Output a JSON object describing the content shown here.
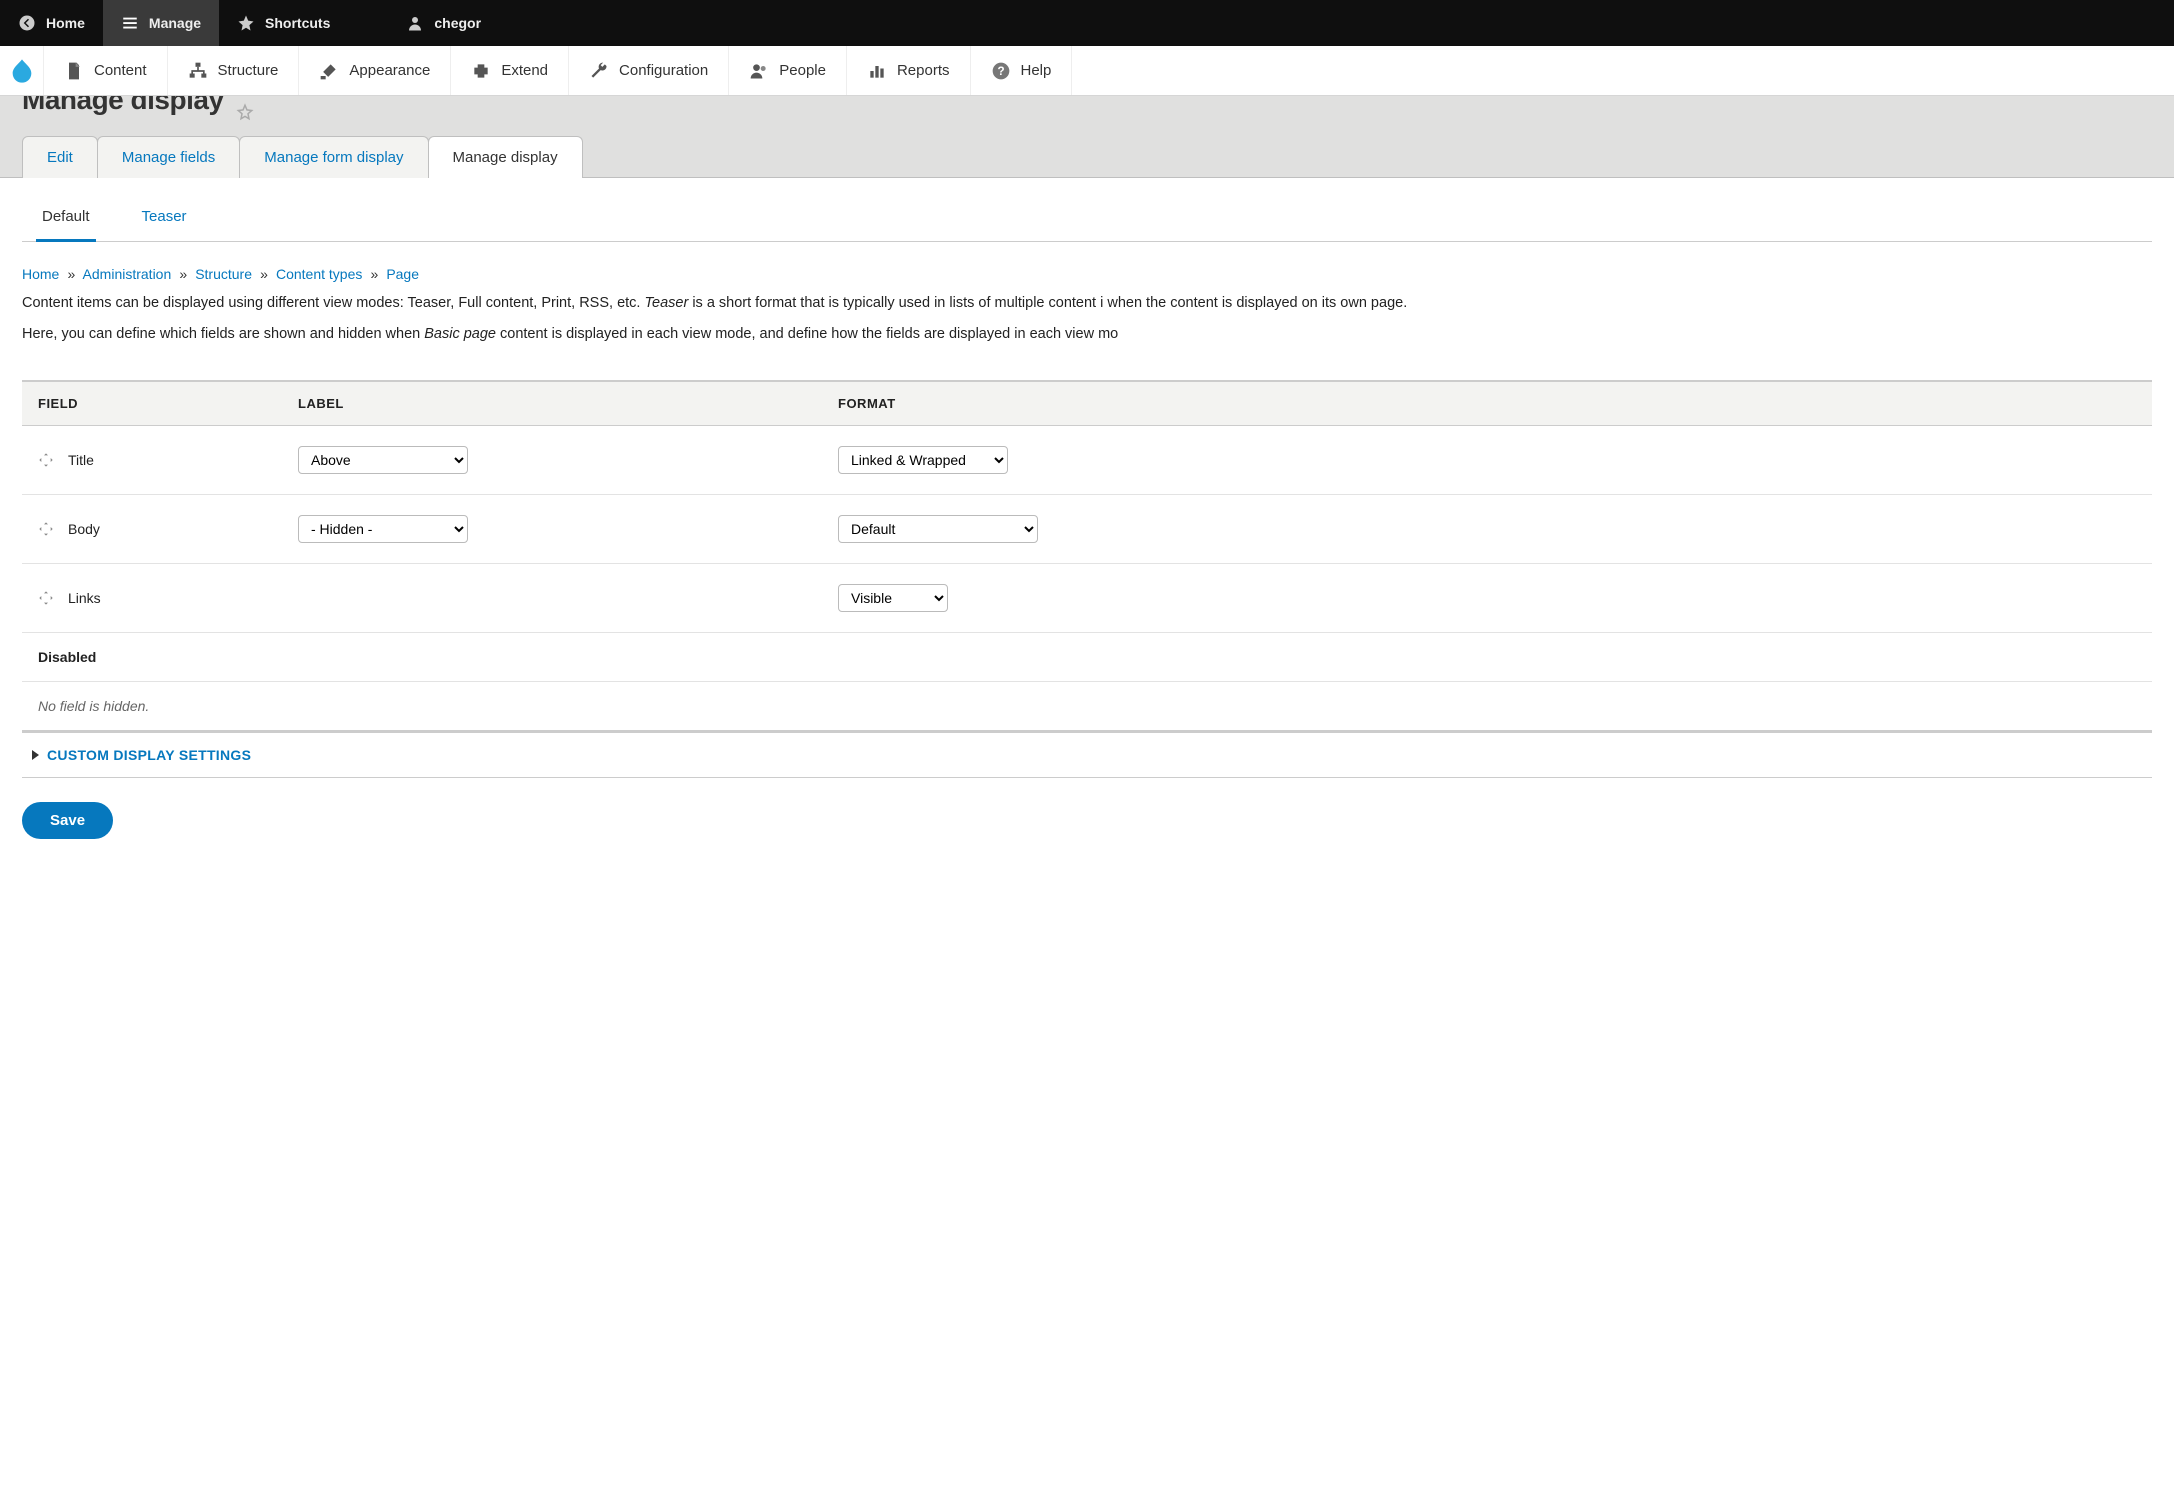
{
  "toolbar": {
    "home": "Home",
    "manage": "Manage",
    "shortcuts": "Shortcuts",
    "user": "chegor"
  },
  "adminbar": {
    "content": "Content",
    "structure": "Structure",
    "appearance": "Appearance",
    "extend": "Extend",
    "configuration": "Configuration",
    "people": "People",
    "reports": "Reports",
    "help": "Help"
  },
  "page": {
    "title": "Manage display"
  },
  "primary_tabs": {
    "edit": "Edit",
    "manage_fields": "Manage fields",
    "manage_form_display": "Manage form display",
    "manage_display": "Manage display"
  },
  "secondary_tabs": {
    "default": "Default",
    "teaser": "Teaser"
  },
  "breadcrumb": {
    "home": "Home",
    "administration": "Administration",
    "structure": "Structure",
    "content_types": "Content types",
    "page": "Page"
  },
  "help": {
    "p1_prefix": "Content items can be displayed using different view modes: Teaser, Full content, Print, RSS, etc. ",
    "p1_em": "Teaser",
    "p1_suffix": " is a short format that is typically used in lists of multiple content i when the content is displayed on its own page.",
    "p2_prefix": "Here, you can define which fields are shown and hidden when ",
    "p2_em": "Basic page",
    "p2_suffix": " content is displayed in each view mode, and define how the fields are displayed in each view mo"
  },
  "table": {
    "head_field": "FIELD",
    "head_label": "LABEL",
    "head_format": "FORMAT",
    "rows": {
      "title": {
        "name": "Title",
        "label_value": "Above",
        "format_value": "Linked & Wrapped"
      },
      "body": {
        "name": "Body",
        "label_value": "- Hidden -",
        "format_value": "Default"
      },
      "links": {
        "name": "Links",
        "format_value": "Visible"
      }
    },
    "disabled_header": "Disabled",
    "empty_text": "No field is hidden."
  },
  "details": {
    "custom": "CUSTOM DISPLAY SETTINGS"
  },
  "buttons": {
    "save": "Save"
  }
}
